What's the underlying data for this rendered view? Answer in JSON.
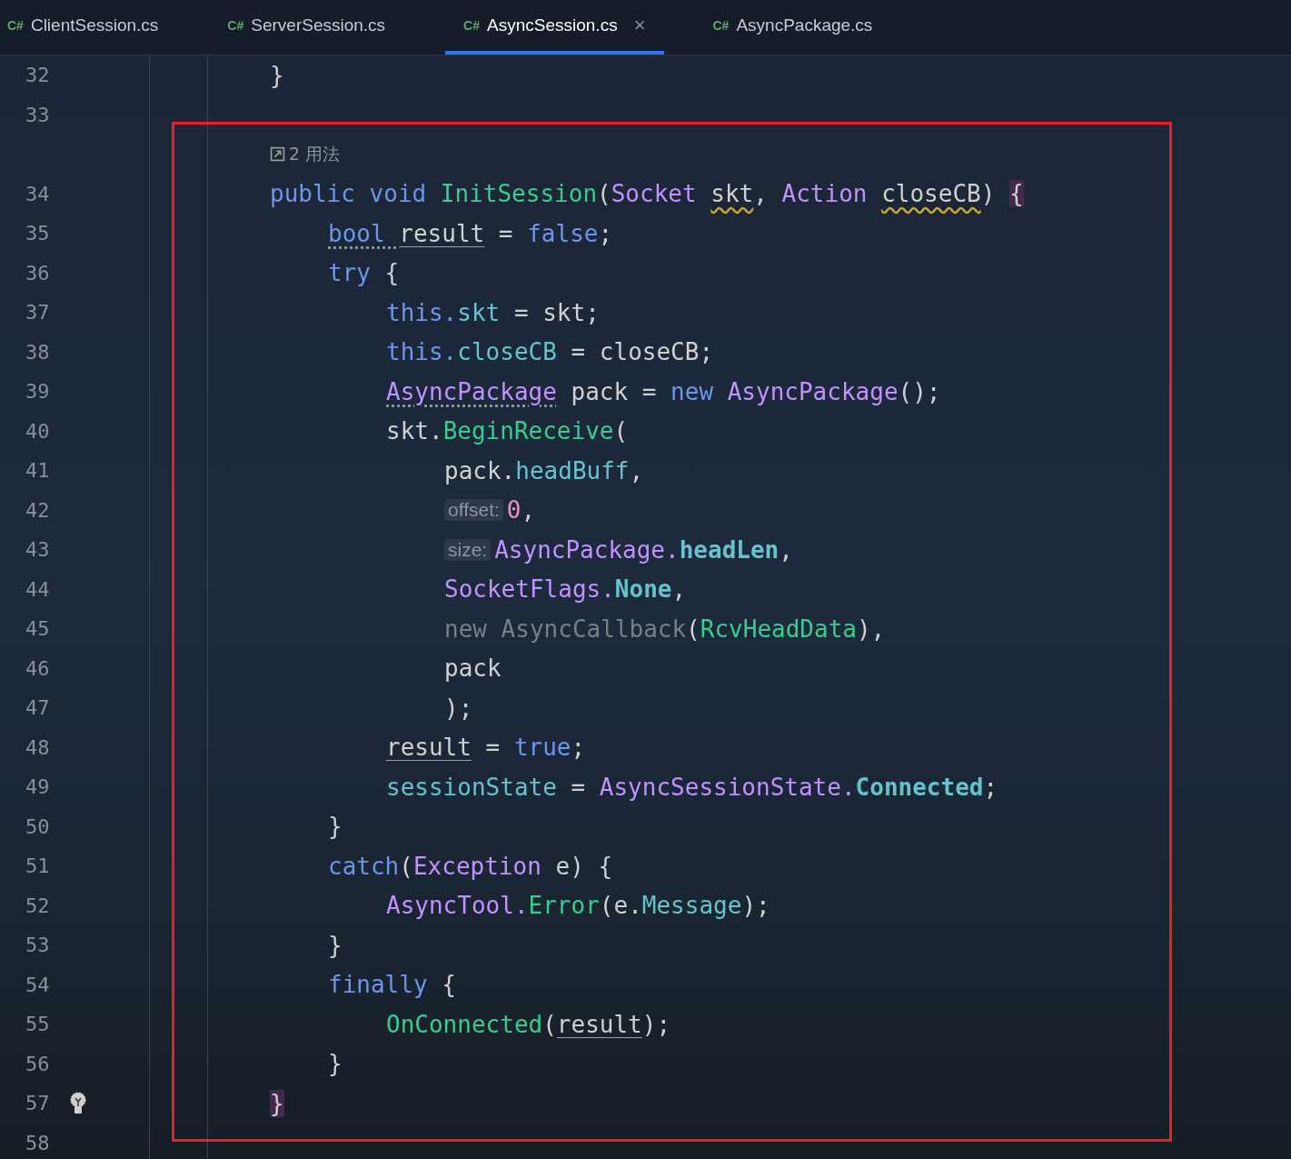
{
  "tabs": [
    {
      "icon": "C#",
      "label": "ClientSession.cs",
      "selected": false
    },
    {
      "icon": "C#",
      "label": "ServerSession.cs",
      "selected": false
    },
    {
      "icon": "C#",
      "label": "AsyncSession.cs",
      "selected": true,
      "close": "×"
    },
    {
      "icon": "C#",
      "label": "AsyncPackage.cs",
      "selected": false
    }
  ],
  "lines": [
    {
      "kind": "code",
      "number": "32",
      "tokens": [
        {
          "t": "}",
          "kind": "plain"
        }
      ]
    },
    {
      "kind": "code",
      "number": "33"
    },
    {
      "kind": "usages",
      "text": "2 用法"
    },
    {
      "kind": "code",
      "number": "34",
      "tokens": [
        {
          "t": "public void ",
          "kind": "keyword"
        },
        {
          "t": "InitSession",
          "kind": "method"
        },
        {
          "t": "(",
          "kind": "plain"
        },
        {
          "t": "Socket ",
          "kind": "type"
        },
        {
          "t": "skt",
          "kind": "warned"
        },
        {
          "t": ", ",
          "kind": "plain"
        },
        {
          "t": "Action ",
          "kind": "type"
        },
        {
          "t": "closeCB",
          "kind": "warned"
        },
        {
          "t": ") ",
          "kind": "plain"
        },
        {
          "t": "{",
          "kind": "brace"
        }
      ],
      "children": [
        {
          "kind": "code",
          "number": "35",
          "tokens": [
            {
              "t": "bool ",
              "kind": "dotkeyword"
            },
            {
              "t": "result",
              "kind": "var"
            },
            {
              "t": " = ",
              "kind": "plain"
            },
            {
              "t": "false",
              "kind": "keyword"
            },
            {
              "t": ";",
              "kind": "plain"
            }
          ]
        },
        {
          "kind": "code",
          "number": "36",
          "tokens": [
            {
              "t": "try",
              "kind": "keyword"
            },
            {
              "t": " {",
              "kind": "plain"
            }
          ],
          "children": [
            {
              "kind": "code",
              "number": "37",
              "tokens": [
                {
                  "t": "this.",
                  "kind": "keyword"
                },
                {
                  "t": "skt",
                  "kind": "field"
                },
                {
                  "t": " = skt;",
                  "kind": "plain"
                }
              ]
            },
            {
              "kind": "code",
              "number": "38",
              "tokens": [
                {
                  "t": "this.",
                  "kind": "keyword"
                },
                {
                  "t": "closeCB",
                  "kind": "field"
                },
                {
                  "t": " = closeCB;",
                  "kind": "plain"
                }
              ]
            },
            {
              "kind": "code",
              "number": "39",
              "tokens": [
                {
                  "t": "AsyncPackage",
                  "kind": "dottype"
                },
                {
                  "t": " pack = ",
                  "kind": "plain"
                },
                {
                  "t": "new ",
                  "kind": "keyword"
                },
                {
                  "t": "AsyncPackage",
                  "kind": "type"
                },
                {
                  "t": "();",
                  "kind": "plain"
                }
              ]
            },
            {
              "kind": "code",
              "number": "40",
              "tokens": [
                {
                  "t": "skt.",
                  "kind": "plain"
                },
                {
                  "t": "BeginReceive",
                  "kind": "method"
                },
                {
                  "t": "(",
                  "kind": "plain"
                }
              ],
              "children": [
                {
                  "kind": "code",
                  "number": "41",
                  "tokens": [
                    {
                      "t": "pack.",
                      "kind": "plain"
                    },
                    {
                      "t": "headBuff",
                      "kind": "field"
                    },
                    {
                      "t": ",",
                      "kind": "plain"
                    }
                  ]
                },
                {
                  "kind": "code",
                  "number": "42",
                  "tokens": [
                    {
                      "t": "offset:",
                      "kind": "hint"
                    },
                    {
                      "t": "0",
                      "kind": "number"
                    },
                    {
                      "t": ",",
                      "kind": "plain"
                    }
                  ]
                },
                {
                  "kind": "code",
                  "number": "43",
                  "tokens": [
                    {
                      "t": "size:",
                      "kind": "hint"
                    },
                    {
                      "t": "AsyncPackage.",
                      "kind": "type"
                    },
                    {
                      "t": "headLen",
                      "kind": "static"
                    },
                    {
                      "t": ",",
                      "kind": "plain"
                    }
                  ]
                },
                {
                  "kind": "code",
                  "number": "44",
                  "tokens": [
                    {
                      "t": "SocketFlags.",
                      "kind": "type"
                    },
                    {
                      "t": "None",
                      "kind": "static"
                    },
                    {
                      "t": ",",
                      "kind": "plain"
                    }
                  ]
                },
                {
                  "kind": "code",
                  "number": "45",
                  "tokens": [
                    {
                      "t": "new AsyncCallback",
                      "kind": "dim"
                    },
                    {
                      "t": "(",
                      "kind": "plain"
                    },
                    {
                      "t": "RcvHeadData",
                      "kind": "method"
                    },
                    {
                      "t": "),",
                      "kind": "plain"
                    }
                  ]
                },
                {
                  "kind": "code",
                  "number": "46",
                  "tokens": [
                    {
                      "t": "pack",
                      "kind": "plain"
                    }
                  ]
                },
                {
                  "kind": "code",
                  "number": "47",
                  "tokens": [
                    {
                      "t": ");",
                      "kind": "plain"
                    }
                  ]
                }
              ]
            },
            {
              "kind": "code",
              "number": "48",
              "tokens": [
                {
                  "t": "result",
                  "kind": "var"
                },
                {
                  "t": " = ",
                  "kind": "plain"
                },
                {
                  "t": "true",
                  "kind": "keyword"
                },
                {
                  "t": ";",
                  "kind": "plain"
                }
              ]
            },
            {
              "kind": "code",
              "number": "49",
              "tokens": [
                {
                  "t": "sessionState",
                  "kind": "field"
                },
                {
                  "t": " = ",
                  "kind": "plain"
                },
                {
                  "t": "AsyncSessionState.",
                  "kind": "type"
                },
                {
                  "t": "Connected",
                  "kind": "static"
                },
                {
                  "t": ";",
                  "kind": "plain"
                }
              ]
            }
          ]
        },
        {
          "kind": "code",
          "number": "50",
          "tokens": [
            {
              "t": "}",
              "kind": "plain"
            }
          ]
        },
        {
          "kind": "code",
          "number": "51",
          "tokens": [
            {
              "t": "catch",
              "kind": "keyword"
            },
            {
              "t": "(",
              "kind": "plain"
            },
            {
              "t": "Exception",
              "kind": "type"
            },
            {
              "t": " e) {",
              "kind": "plain"
            }
          ],
          "children": [
            {
              "kind": "code",
              "number": "52",
              "tokens": [
                {
                  "t": "AsyncTool.",
                  "kind": "type"
                },
                {
                  "t": "Error",
                  "kind": "method"
                },
                {
                  "t": "(e.",
                  "kind": "plain"
                },
                {
                  "t": "Message",
                  "kind": "field"
                },
                {
                  "t": ");",
                  "kind": "plain"
                }
              ]
            }
          ]
        },
        {
          "kind": "code",
          "number": "53",
          "tokens": [
            {
              "t": "}",
              "kind": "plain"
            }
          ]
        },
        {
          "kind": "code",
          "number": "54",
          "tokens": [
            {
              "t": "finally",
              "kind": "keyword"
            },
            {
              "t": " {",
              "kind": "plain"
            }
          ],
          "children": [
            {
              "kind": "code",
              "number": "55",
              "tokens": [
                {
                  "t": "OnConnected",
                  "kind": "method"
                },
                {
                  "t": "(",
                  "kind": "plain"
                },
                {
                  "t": "result",
                  "kind": "var"
                },
                {
                  "t": ");",
                  "kind": "plain"
                }
              ]
            }
          ]
        },
        {
          "kind": "code",
          "number": "56",
          "tokens": [
            {
              "t": "}",
              "kind": "plain"
            }
          ]
        }
      ]
    },
    {
      "kind": "code",
      "number": "57",
      "bulb": true,
      "tokens": [
        {
          "t": "}",
          "kind": "brace"
        }
      ]
    },
    {
      "kind": "code",
      "number": "58"
    }
  ]
}
